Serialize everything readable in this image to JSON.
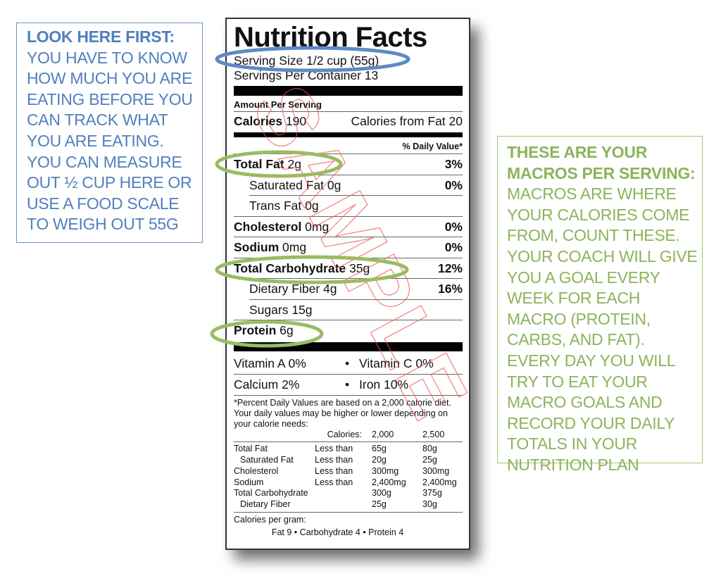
{
  "callouts": {
    "left": {
      "heading": "LOOK HERE FIRST:",
      "body": "YOU HAVE TO KNOW HOW MUCH YOU ARE EATING BEFORE YOU CAN TRACK WHAT YOU ARE EATING. YOU CAN MEASURE OUT ½ CUP HERE OR USE A FOOD SCALE TO WEIGH OUT 55G",
      "color": "#4f80bd",
      "border_color": "#6c96c8"
    },
    "right": {
      "heading": "THESE ARE YOUR MACROS PER SERVING:",
      "body": "MACROS ARE WHERE YOUR CALORIES COME FROM, COUNT THESE. YOUR COACH WILL GIVE YOU A GOAL EVERY WEEK FOR EACH MACRO (PROTEIN, CARBS, AND FAT). EVERY DAY YOU WILL TRY TO EAT YOUR MACRO GOALS AND RECORD YOUR DAILY TOTALS IN YOUR NUTRITION PLAN",
      "color": "#8db35a",
      "border_color": "#a6c47a"
    }
  },
  "label": {
    "title": "Nutrition Facts",
    "serving_size": "Serving Size 1/2 cup (55g)",
    "servings_per_container": "Servings Per Container 13",
    "amount_per_serving": "Amount Per Serving",
    "calories_label": "Calories",
    "calories_value": "190",
    "calories_from_fat": "Calories from Fat 20",
    "daily_value_header": "% Daily Value*",
    "nutrients": [
      {
        "name": "Total Fat",
        "amount": "2g",
        "dv": "3%",
        "bold": true
      },
      {
        "name": "Saturated Fat",
        "amount": "0g",
        "dv": "0%",
        "bold": false
      },
      {
        "name": "Trans Fat",
        "amount": "0g",
        "dv": "",
        "bold": false
      },
      {
        "name": "Cholesterol",
        "amount": "0mg",
        "dv": "0%",
        "bold": true
      },
      {
        "name": "Sodium",
        "amount": "0mg",
        "dv": "0%",
        "bold": true
      },
      {
        "name": "Total Carbohydrate",
        "amount": "35g",
        "dv": "12%",
        "bold": true
      },
      {
        "name": "Dietary Fiber",
        "amount": "4g",
        "dv": "16%",
        "bold": false
      },
      {
        "name": "Sugars",
        "amount": "15g",
        "dv": "",
        "bold": false
      },
      {
        "name": "Protein",
        "amount": "6g",
        "dv": "",
        "bold": true
      }
    ],
    "vitamins": [
      {
        "left": "Vitamin A 0%",
        "bullet": "•",
        "right": "Vitamin C 0%"
      },
      {
        "left": "Calcium 2%",
        "bullet": "•",
        "right": "Iron 10%"
      }
    ],
    "footnote": "*Percent Daily Values are based on a 2,000 calorie diet. Your daily values may be higher or lower depending on your calorie needs:",
    "dv_table": {
      "header": [
        "",
        "Calories:",
        "2,000",
        "2,500"
      ],
      "rows": [
        [
          "Total Fat",
          "Less than",
          "65g",
          "80g"
        ],
        [
          "Saturated Fat",
          "Less than",
          "20g",
          "25g"
        ],
        [
          "Cholesterol",
          "Less than",
          "300mg",
          "300mg"
        ],
        [
          "Sodium",
          "Less than",
          "2,400mg",
          "2,400mg"
        ],
        [
          "Total Carbohydrate",
          "",
          "300g",
          "375g"
        ],
        [
          "Dietary Fiber",
          "",
          "25g",
          "30g"
        ]
      ]
    },
    "calories_per_gram_label": "Calories per gram:",
    "calories_per_gram": "Fat 9  •  Carbohydrate 4  •  Protein 4",
    "watermark": "SAMPLE",
    "watermark_color": "#ee5555"
  },
  "highlights": {
    "serving_color": "#5b8ac6",
    "macro_color": "#9bbb62"
  }
}
